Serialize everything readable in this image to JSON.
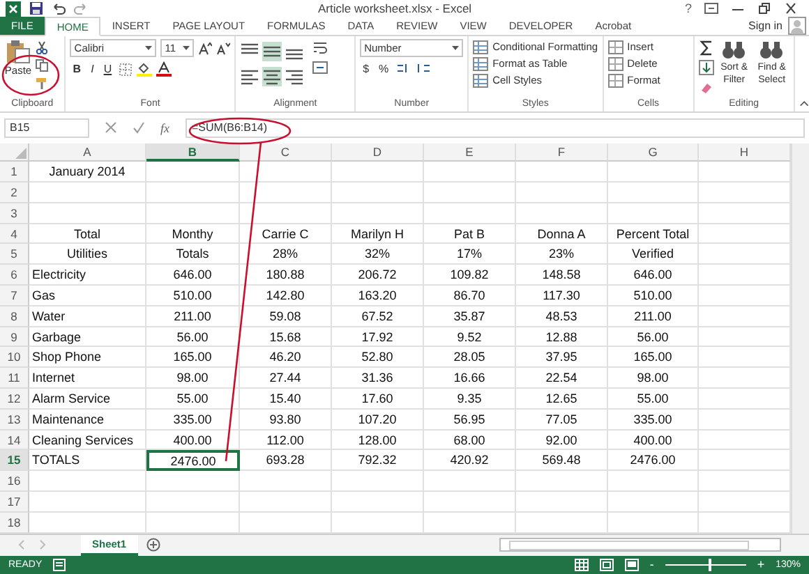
{
  "title_bar": {
    "title": "Article worksheet.xlsx - Excel",
    "help": "?"
  },
  "file_tab": "FILE",
  "tabs": [
    {
      "label": "HOME",
      "selected": true
    },
    {
      "label": "INSERT",
      "selected": false
    },
    {
      "label": "PAGE LAYOUT",
      "selected": false
    },
    {
      "label": "FORMULAS",
      "selected": false
    },
    {
      "label": "DATA",
      "selected": false
    },
    {
      "label": "REVIEW",
      "selected": false
    },
    {
      "label": "VIEW",
      "selected": false
    },
    {
      "label": "DEVELOPER",
      "selected": false
    },
    {
      "label": "Acrobat",
      "selected": false
    }
  ],
  "sign_in": "Sign in",
  "ribbon": {
    "clipboard": {
      "label": "Clipboard",
      "paste": "Paste"
    },
    "font": {
      "label": "Font",
      "font_name": "Calibri",
      "font_size": "11",
      "bold": "B",
      "italic": "I",
      "underline": "U"
    },
    "alignment": {
      "label": "Alignment",
      "buttons": [
        {
          "kind": "top",
          "selected": false
        },
        {
          "kind": "middle",
          "selected": true
        },
        {
          "kind": "bottom",
          "selected": false
        },
        {
          "kind": "left",
          "selected": false
        },
        {
          "kind": "center",
          "selected": true
        },
        {
          "kind": "right",
          "selected": false
        }
      ]
    },
    "number": {
      "label": "Number",
      "format": "Number",
      "currency": "$",
      "percent": "%"
    },
    "styles": {
      "label": "Styles",
      "items": [
        "Conditional Formatting",
        "Format as Table",
        "Cell Styles"
      ]
    },
    "cells": {
      "label": "Cells",
      "items": [
        "Insert",
        "Delete",
        "Format"
      ]
    },
    "editing": {
      "label": "Editing",
      "items": [
        "Sort & Filter",
        "Find & Select"
      ]
    }
  },
  "formula_bar": {
    "cell_ref": "B15",
    "function_label": "fx",
    "formula": "=SUM(B6:B14)"
  },
  "sheet": {
    "columns": [
      {
        "label": "A",
        "selected": false
      },
      {
        "label": "B",
        "selected": true
      },
      {
        "label": "C",
        "selected": false
      },
      {
        "label": "D",
        "selected": false
      },
      {
        "label": "E",
        "selected": false
      },
      {
        "label": "F",
        "selected": false
      },
      {
        "label": "G",
        "selected": false
      },
      {
        "label": "H",
        "selected": false
      }
    ],
    "rows": [
      {
        "number": "1",
        "selected": false,
        "kind": "header",
        "cells": [
          "January 2014"
        ]
      },
      {
        "number": "2",
        "selected": false
      },
      {
        "number": "3",
        "selected": false
      },
      {
        "number": "4",
        "selected": false,
        "kind": "header",
        "cells": [
          "Total",
          "Monthy",
          "Carrie C",
          "Marilyn H",
          "Pat B",
          "Donna A",
          "Percent Total"
        ]
      },
      {
        "number": "5",
        "selected": false,
        "kind": "header",
        "cells": [
          "Utilities",
          "Totals",
          "28%",
          "32%",
          "17%",
          "23%",
          "Verified"
        ]
      },
      {
        "number": "6",
        "selected": false,
        "kind": "data",
        "cells": [
          "Electricity",
          "646.00",
          "180.88",
          "206.72",
          "109.82",
          "148.58",
          "646.00"
        ]
      },
      {
        "number": "7",
        "selected": false,
        "kind": "data",
        "cells": [
          "Gas",
          "510.00",
          "142.80",
          "163.20",
          "86.70",
          "117.30",
          "510.00"
        ]
      },
      {
        "number": "8",
        "selected": false,
        "kind": "data",
        "cells": [
          "Water",
          "211.00",
          "59.08",
          "67.52",
          "35.87",
          "48.53",
          "211.00"
        ]
      },
      {
        "number": "9",
        "selected": false,
        "kind": "data",
        "cells": [
          "Garbage",
          "56.00",
          "15.68",
          "17.92",
          "9.52",
          "12.88",
          "56.00"
        ]
      },
      {
        "number": "10",
        "selected": false,
        "kind": "data",
        "cells": [
          "Shop Phone",
          "165.00",
          "46.20",
          "52.80",
          "28.05",
          "37.95",
          "165.00"
        ]
      },
      {
        "number": "11",
        "selected": false,
        "kind": "data",
        "cells": [
          "Internet",
          "98.00",
          "27.44",
          "31.36",
          "16.66",
          "22.54",
          "98.00"
        ]
      },
      {
        "number": "12",
        "selected": false,
        "kind": "data",
        "cells": [
          "Alarm Service",
          "55.00",
          "15.40",
          "17.60",
          "9.35",
          "12.65",
          "55.00"
        ]
      },
      {
        "number": "13",
        "selected": false,
        "kind": "data",
        "cells": [
          "Maintenance",
          "335.00",
          "93.80",
          "107.20",
          "56.95",
          "77.05",
          "335.00"
        ]
      },
      {
        "number": "14",
        "selected": false,
        "kind": "data",
        "cells": [
          "Cleaning Services",
          "400.00",
          "112.00",
          "128.00",
          "68.00",
          "92.00",
          "400.00"
        ]
      },
      {
        "number": "15",
        "selected": true,
        "kind": "data",
        "cells": [
          "TOTALS",
          "2476.00",
          "693.28",
          "792.32",
          "420.92",
          "569.48",
          "2476.00"
        ]
      },
      {
        "number": "16",
        "selected": false
      },
      {
        "number": "17",
        "selected": false
      },
      {
        "number": "18",
        "selected": false
      }
    ]
  },
  "sheet_tabs": [
    {
      "label": "Sheet1",
      "selected": true
    }
  ],
  "status_bar": {
    "status": "READY",
    "zoom_out": "-",
    "zoom_in": "+",
    "level": 0.55,
    "zoom": "130%"
  }
}
